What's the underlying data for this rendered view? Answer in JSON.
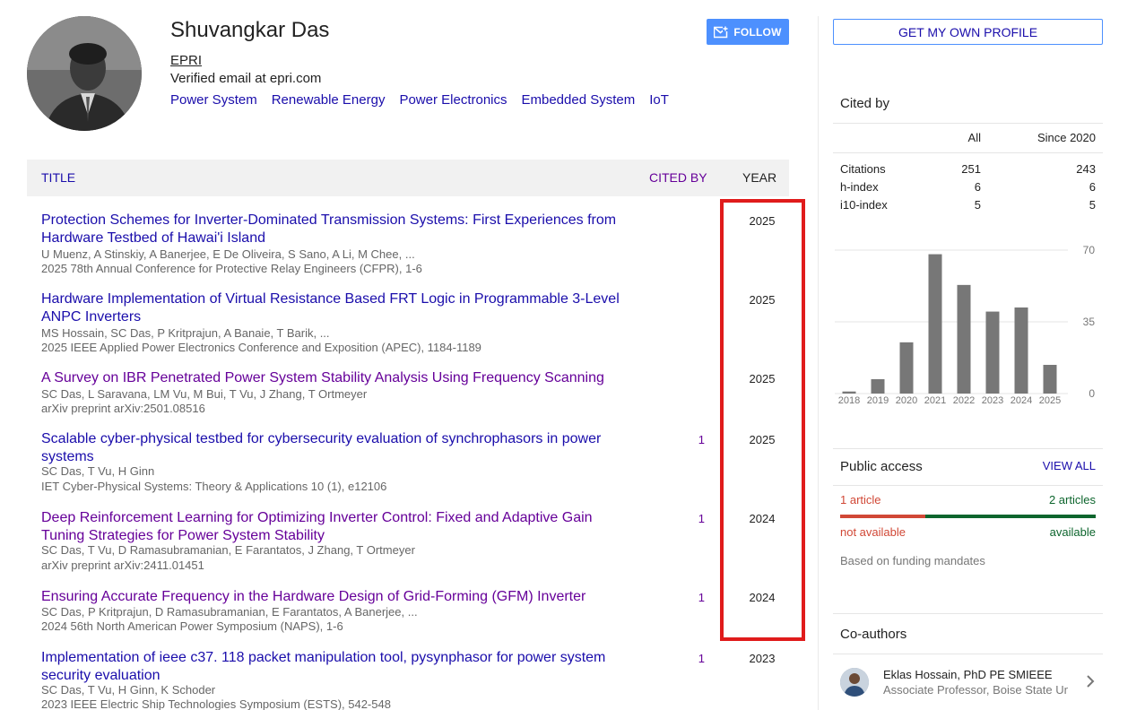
{
  "profile": {
    "name": "Shuvangkar Das",
    "affiliation": "EPRI",
    "email": "Verified email at epri.com",
    "interests": [
      "Power System",
      "Renewable Energy",
      "Power Electronics",
      "Embedded System",
      "IoT"
    ],
    "follow_label": "FOLLOW"
  },
  "table": {
    "col_title": "TITLE",
    "col_cited": "CITED BY",
    "col_year": "YEAR",
    "rows": [
      {
        "title": "Protection Schemes for Inverter-Dominated Transmission Systems: First Experiences from Hardware Testbed of Hawai'i Island",
        "authors": "U Muenz, A Stinskiy, A Banerjee, E De Oliveira, S Sano, A Li, M Chee, ...",
        "venue": "2025 78th Annual Conference for Protective Relay Engineers (CFPR), 1-6",
        "cited": "",
        "year": "2025"
      },
      {
        "title": "Hardware Implementation of Virtual Resistance Based FRT Logic in Programmable 3-Level ANPC Inverters",
        "authors": "MS Hossain, SC Das, P Kritprajun, A Banaie, T Barik, ...",
        "venue": "2025 IEEE Applied Power Electronics Conference and Exposition (APEC), 1184-1189",
        "cited": "",
        "year": "2025"
      },
      {
        "title": "A Survey on IBR Penetrated Power System Stability Analysis Using Frequency Scanning",
        "authors": "SC Das, L Saravana, LM Vu, M Bui, T Vu, J Zhang, T Ortmeyer",
        "venue": "arXiv preprint arXiv:2501.08516",
        "cited": "",
        "year": "2025"
      },
      {
        "title": "Scalable cyber-physical testbed for cybersecurity evaluation of synchrophasors in power systems",
        "authors": "SC Das, T Vu, H Ginn",
        "venue": "IET Cyber-Physical Systems: Theory & Applications 10 (1), e12106",
        "cited": "1",
        "year": "2025"
      },
      {
        "title": "Deep Reinforcement Learning for Optimizing Inverter Control: Fixed and Adaptive Gain Tuning Strategies for Power System Stability",
        "authors": "SC Das, T Vu, D Ramasubramanian, E Farantatos, J Zhang, T Ortmeyer",
        "venue": "arXiv preprint arXiv:2411.01451",
        "cited": "1",
        "year": "2024"
      },
      {
        "title": "Ensuring Accurate Frequency in the Hardware Design of Grid-Forming (GFM) Inverter",
        "authors": "SC Das, P Kritprajun, D Ramasubramanian, E Farantatos, A Banerjee, ...",
        "venue": "2024 56th North American Power Symposium (NAPS), 1-6",
        "cited": "1",
        "year": "2024"
      },
      {
        "title": "Implementation of ieee c37. 118 packet manipulation tool, pysynphasor for power system security evaluation",
        "authors": "SC Das, T Vu, H Ginn, K Schoder",
        "venue": "2023 IEEE Electric Ship Technologies Symposium (ESTS), 542-548",
        "cited": "1",
        "year": "2023"
      }
    ]
  },
  "sidebar": {
    "get_profile_label": "GET MY OWN PROFILE",
    "cited_by": {
      "title": "Cited by",
      "col_all": "All",
      "col_since": "Since 2020",
      "rows": [
        {
          "label": "Citations",
          "all": "251",
          "since": "243"
        },
        {
          "label": "h-index",
          "all": "6",
          "since": "6"
        },
        {
          "label": "i10-index",
          "all": "5",
          "since": "5"
        }
      ]
    },
    "public_access": {
      "title": "Public access",
      "view_all": "VIEW ALL",
      "left_count": "1 article",
      "right_count": "2 articles",
      "left_status": "not available",
      "right_status": "available",
      "note": "Based on funding mandates",
      "color_unavailable": "#d14836",
      "color_available": "#0d652d"
    },
    "coauthors": {
      "title": "Co-authors",
      "items": [
        {
          "name": "Eklas Hossain, PhD PE SMIEEE",
          "affiliation": "Associate Professor, Boise State University"
        }
      ]
    }
  },
  "chart_data": {
    "type": "bar",
    "categories": [
      "2018",
      "2019",
      "2020",
      "2021",
      "2022",
      "2023",
      "2024",
      "2025"
    ],
    "values": [
      1,
      7,
      25,
      68,
      53,
      40,
      42,
      14
    ],
    "ylim": [
      0,
      70
    ],
    "yticks": [
      "70",
      "35",
      "0"
    ],
    "bar_color": "#777777",
    "grid": true
  }
}
